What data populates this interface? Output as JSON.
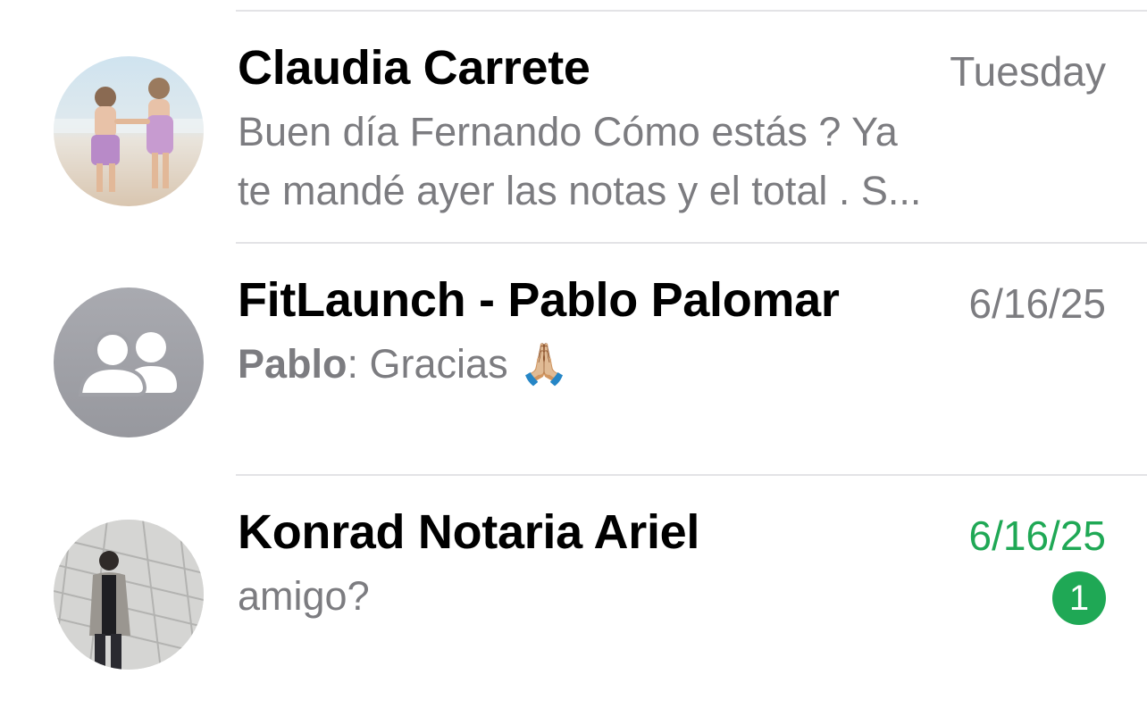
{
  "chats": [
    {
      "name": "Claudia Carrete",
      "date": "Tuesday",
      "preview_line1": "Buen día Fernando Cómo estás ? Ya",
      "preview_line2": "te mandé ayer las notas y el total . S..."
    },
    {
      "name": "FitLaunch - Pablo Palomar",
      "date": "6/16/25",
      "preview_sender": "Pablo",
      "preview_sep": ": ",
      "preview_text": "Gracias",
      "preview_emoji": "🙏🏼"
    },
    {
      "name": "Konrad Notaria Ariel",
      "date": "6/16/25",
      "preview_text": "amigo?",
      "unread_count": "1"
    }
  ],
  "colors": {
    "unread_accent": "#1fa855",
    "secondary_text": "#7c7c80",
    "divider": "#e3e3e6",
    "group_avatar_bg": "#a3a4aa"
  },
  "icons": {
    "group_avatar": "group-people-icon"
  }
}
